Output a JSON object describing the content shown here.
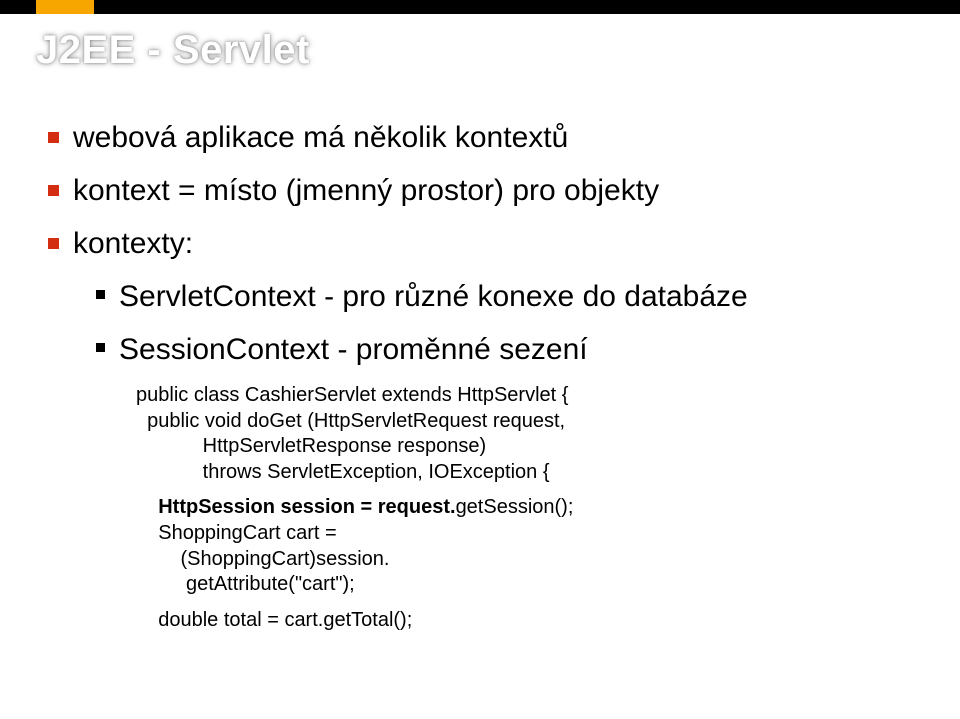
{
  "title": "J2EE - Servlet",
  "bullets": {
    "b1": "webová aplikace má několik kontextů",
    "b2": "kontext = místo (jmenný prostor) pro objekty",
    "b3": "kontexty:",
    "b4": "ServletContext - pro různé konexe do databáze",
    "b5": "SessionContext - proměnné sezení"
  },
  "code": {
    "l1": "public class CashierServlet extends HttpServlet {",
    "l2": "  public void doGet (HttpServletRequest request,",
    "l3": "            HttpServletResponse response)",
    "l4": "            throws ServletException, IOException {",
    "l5a": "    ",
    "l5b": "HttpSession session = request.",
    "l5c": "getSession();",
    "l6": "    ShoppingCart cart =",
    "l7": "        (ShoppingCart)session.",
    "l8": "         getAttribute(\"cart\");",
    "l9": "    double total = cart.getTotal();"
  }
}
